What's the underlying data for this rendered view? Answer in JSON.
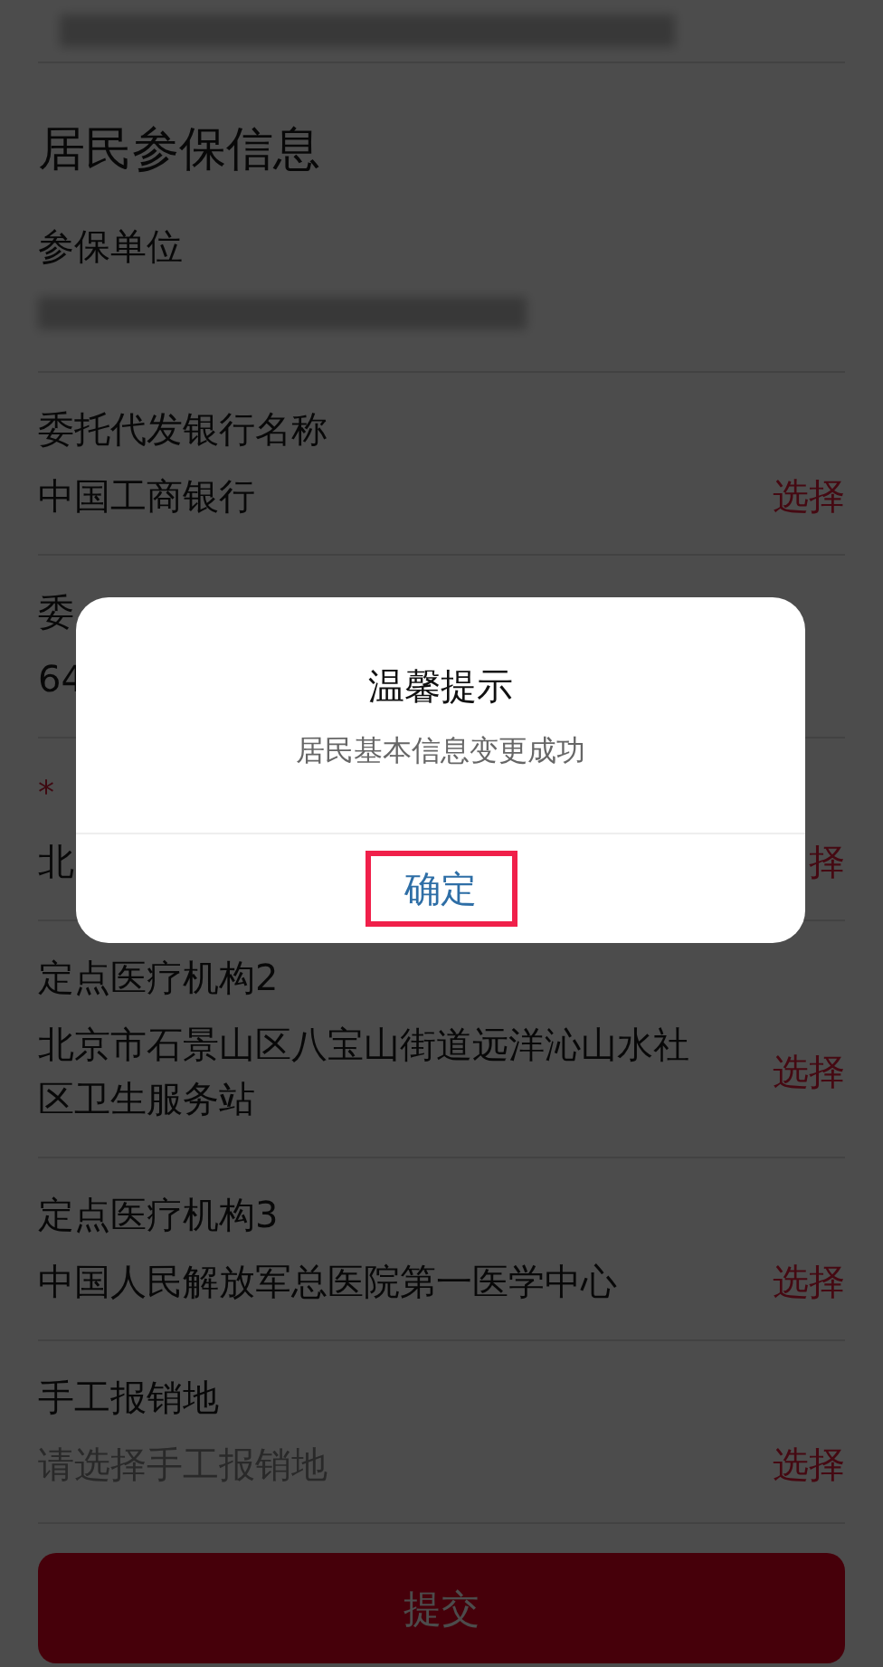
{
  "section_title": "居民参保信息",
  "fields": [
    {
      "kind": "redacted",
      "label": "参保单位"
    },
    {
      "kind": "select",
      "label": "委托代发银行名称",
      "value": "中国工商银行",
      "action": "选择"
    },
    {
      "kind": "text",
      "label": "委",
      "value": "64"
    },
    {
      "kind": "select",
      "required_mark": "*",
      "value": "北",
      "action": "择"
    },
    {
      "kind": "select",
      "label": "定点医疗机构2",
      "value": "北京市石景山区八宝山街道远洋沁山水社区卫生服务站",
      "action": "选择"
    },
    {
      "kind": "select",
      "label": "定点医疗机构3",
      "value": "中国人民解放军总医院第一医学中心",
      "action": "选择"
    },
    {
      "kind": "select",
      "label": "手工报销地",
      "placeholder": "请选择手工报销地",
      "action": "选择"
    }
  ],
  "submit": "提交",
  "dialog": {
    "title": "温馨提示",
    "message": "居民基本信息变更成功",
    "confirm": {
      "label": "确定",
      "highlighted": true
    }
  }
}
